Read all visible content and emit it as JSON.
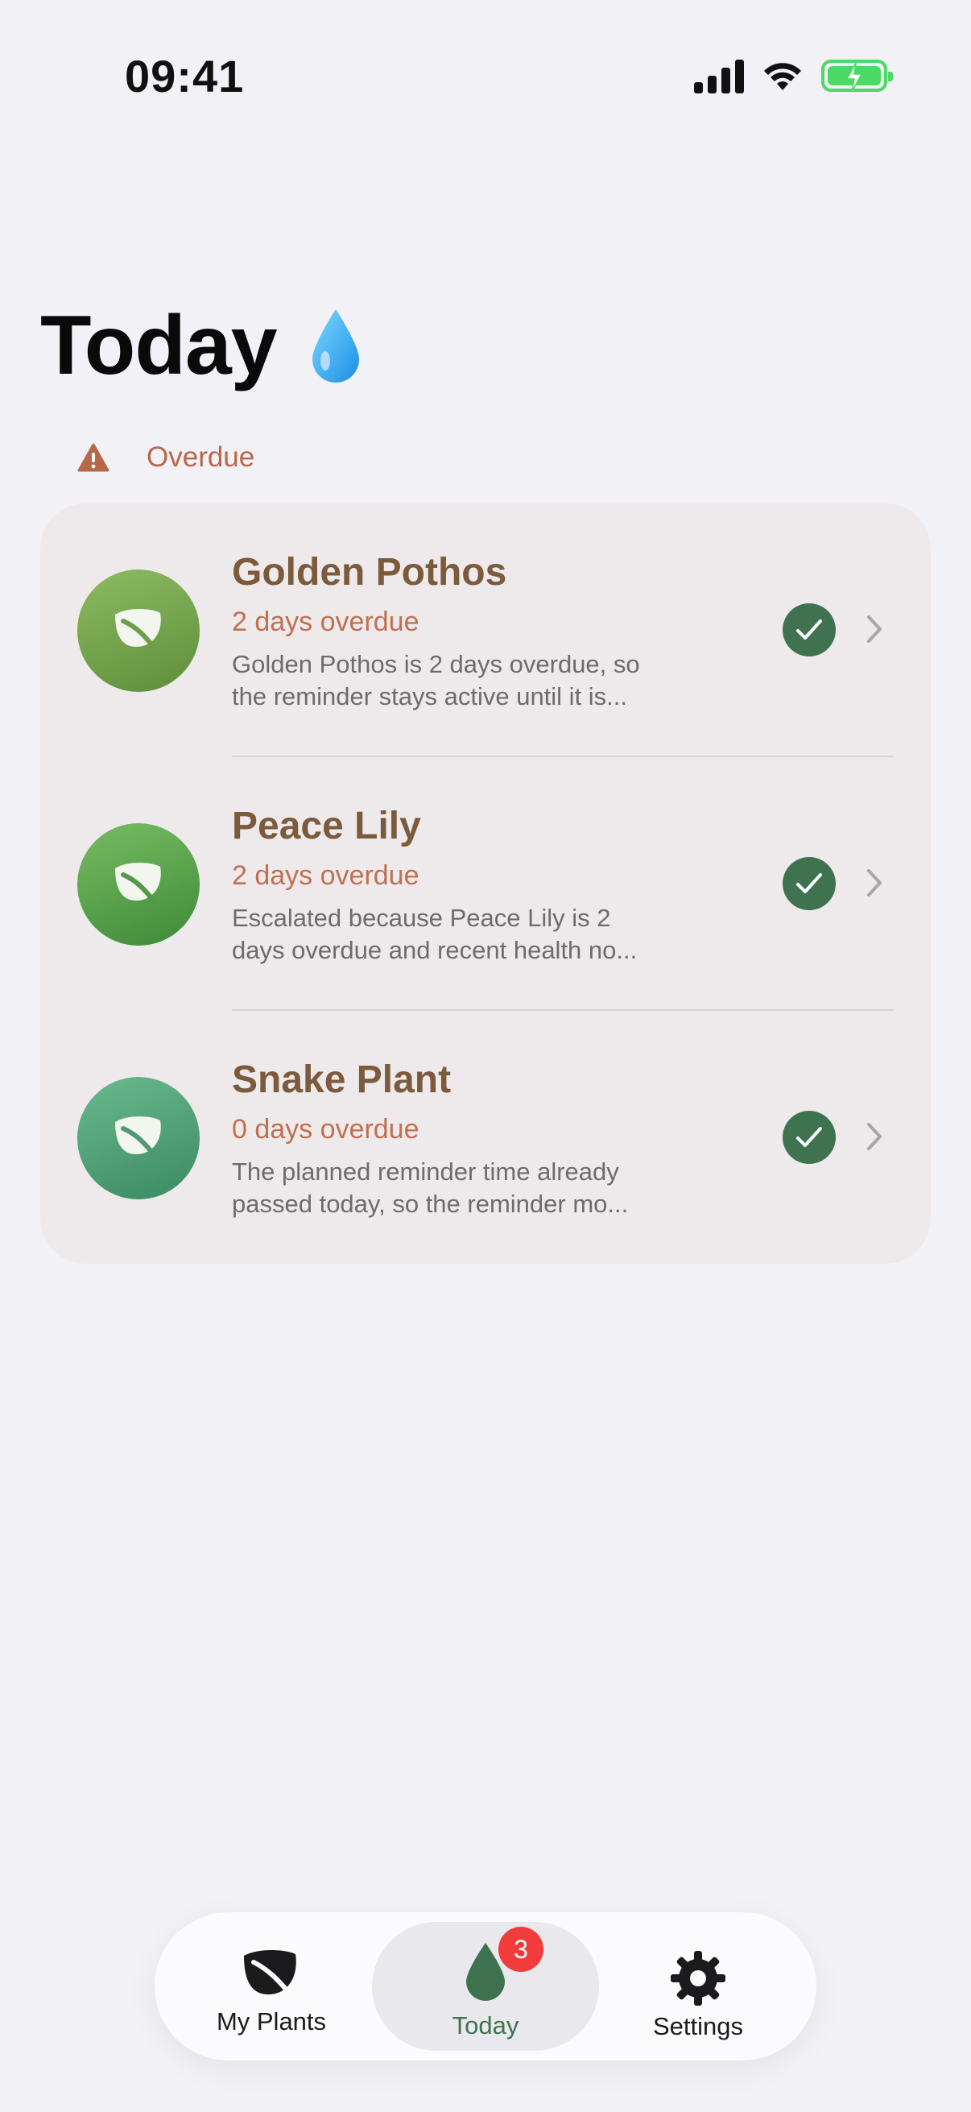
{
  "status_bar": {
    "time": "09:41"
  },
  "header": {
    "title": "Today",
    "title_icon": "water-drop-icon"
  },
  "section": {
    "title": "Overdue",
    "icon": "warning-triangle-icon"
  },
  "plants": [
    {
      "name": "Golden Pothos",
      "status": "2 days overdue",
      "desc_line1": "Golden Pothos is 2 days overdue, so",
      "desc_line2": "the reminder stays active until it is...",
      "avatar_color_top": "#8dbb61",
      "avatar_color_bottom": "#5f8e3c"
    },
    {
      "name": "Peace Lily",
      "status": "2 days overdue",
      "desc_line1": "Escalated because Peace Lily is 2",
      "desc_line2": "days overdue and recent health no...",
      "avatar_color_top": "#78bc62",
      "avatar_color_bottom": "#3e8a38"
    },
    {
      "name": "Snake Plant",
      "status": "0 days overdue",
      "desc_line1": "The planned reminder time already",
      "desc_line2": "passed today, so the reminder mo...",
      "avatar_color_top": "#6bb98e",
      "avatar_color_bottom": "#3a8a62"
    }
  ],
  "tabs": {
    "my_plants": {
      "label": "My Plants",
      "icon": "leaf-icon"
    },
    "today": {
      "label": "Today",
      "icon": "water-drop-icon",
      "badge": "3"
    },
    "settings": {
      "label": "Settings",
      "icon": "gear-icon"
    }
  },
  "colors": {
    "background": "#f2f1f6",
    "accent_green": "#3f7350",
    "overdue": "#c07050",
    "plant_name": "#7c5a3c",
    "badge": "#f23c3c"
  }
}
